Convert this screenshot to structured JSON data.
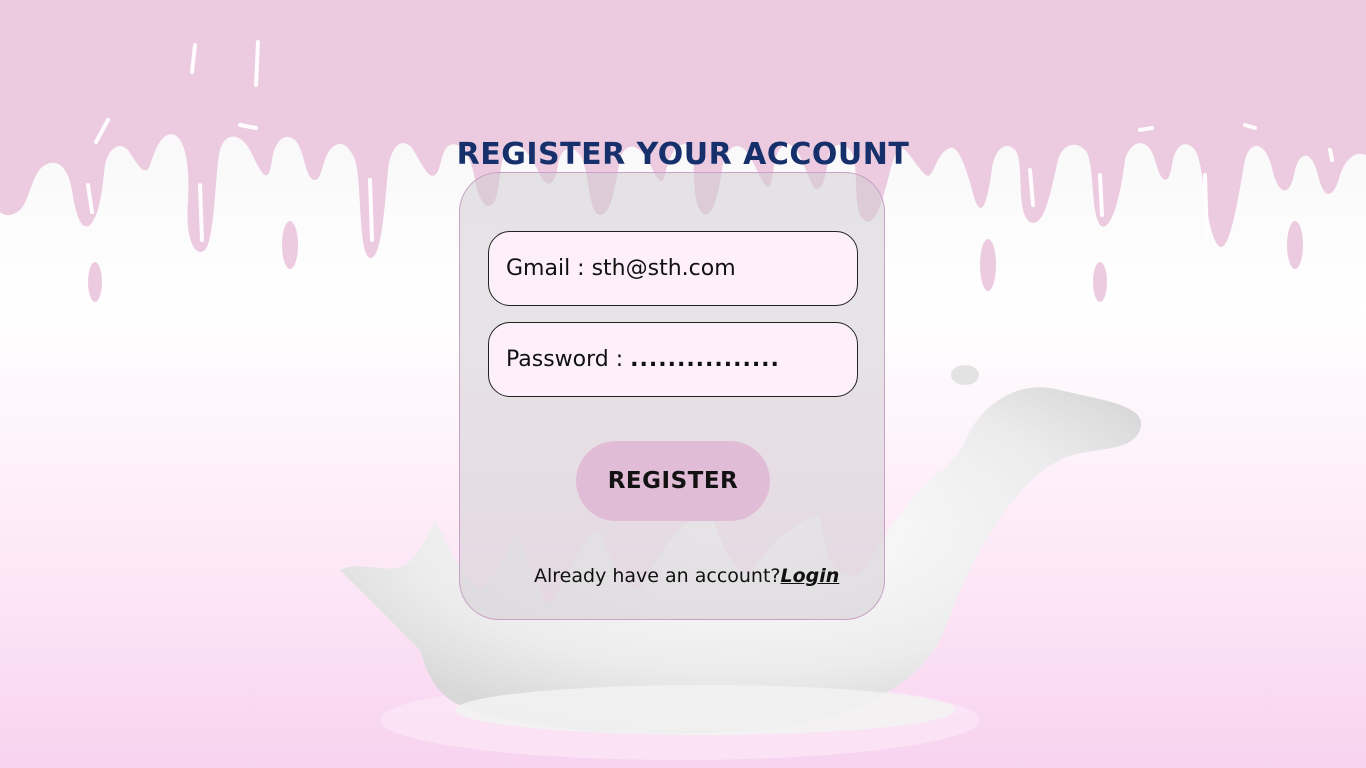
{
  "page": {
    "title": "REGISTER YOUR ACCOUNT"
  },
  "form": {
    "email_label": "Gmail :",
    "email_value": "sth@sth.com",
    "password_label": "Password :",
    "password_value": "................",
    "register_label": "REGISTER",
    "login_prompt": "Already have an account?",
    "login_link": "Login"
  },
  "colors": {
    "title": "#16306b",
    "drip": "#eccbe0",
    "button": "#e0bcd6",
    "field_bg": "#fdf0fb",
    "card_border": "#c9a0c6"
  }
}
